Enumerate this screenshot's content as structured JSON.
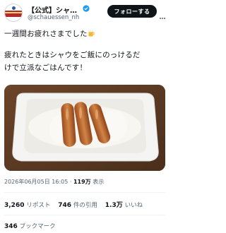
{
  "account": {
    "name": "【公式】シャウエッセン",
    "handle": "@schauessen_nh",
    "follow_label": "フォローする"
  },
  "tweet": {
    "line1": "一週間お疲れさまでした",
    "line2": "疲れたときはシャウをご飯にのっけるだ",
    "line3": "けで立派なごはんです！"
  },
  "meta": {
    "timestamp": "2026年06月05日 16:05",
    "separator": "·",
    "views_count": "119万",
    "views_label": "表示"
  },
  "stats": {
    "reposts_count": "3,260",
    "reposts_label": "リポスト",
    "quotes_count": "746",
    "quotes_label": "件の引用",
    "likes_count": "1.3万",
    "likes_label": "いいね",
    "bookmarks_count": "346",
    "bookmarks_label": "ブックマーク"
  },
  "icons": {
    "verified": "verified-badge-icon",
    "more": "more-options-icon",
    "emoji": "beer-mug-emoji"
  },
  "colors": {
    "verified": "#1d9bf0",
    "follow_button": "#0f1419",
    "secondary_text": "#536471"
  }
}
